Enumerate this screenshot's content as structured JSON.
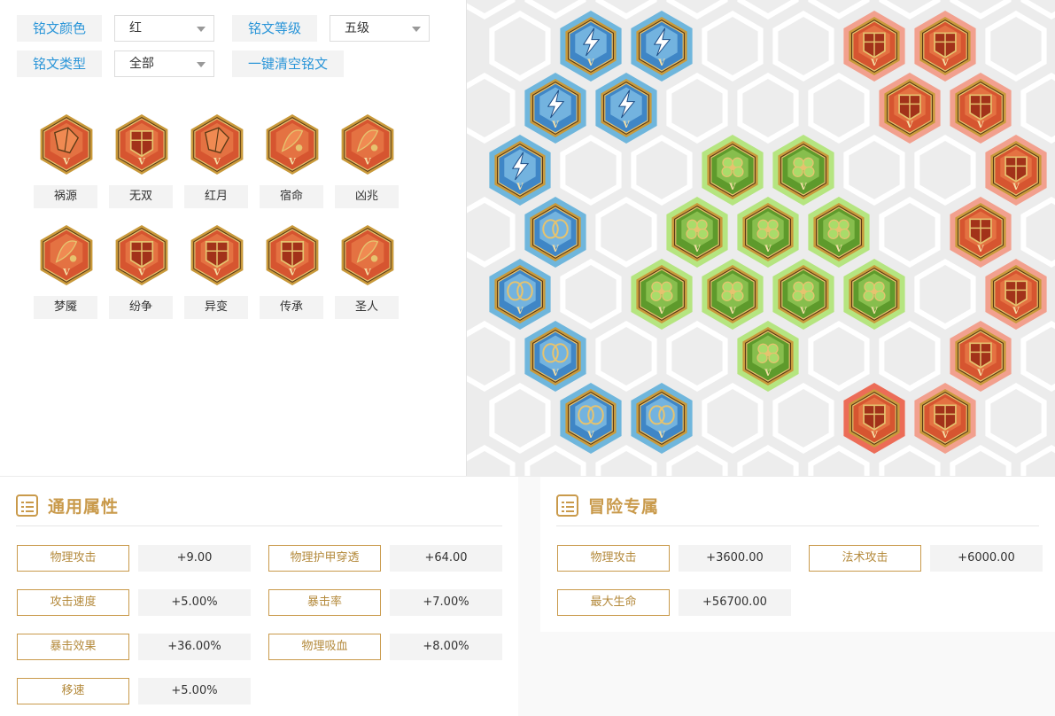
{
  "filters": {
    "color_label": "铭文颜色",
    "color_value": "红",
    "level_label": "铭文等级",
    "level_value": "五级",
    "type_label": "铭文类型",
    "type_value": "全部",
    "clear_button": "一键清空铭文"
  },
  "rune_level_mark": "V",
  "runes": [
    {
      "name": "祸源",
      "icon": "broken-shard-emblem-icon"
    },
    {
      "name": "无双",
      "icon": "shield-emblem-icon"
    },
    {
      "name": "红月",
      "icon": "broken-shard-emblem-icon"
    },
    {
      "name": "宿命",
      "icon": "feather-emblem-icon"
    },
    {
      "name": "凶兆",
      "icon": "feather-emblem-icon"
    },
    {
      "name": "梦魇",
      "icon": "feather-emblem-icon"
    },
    {
      "name": "纷争",
      "icon": "shield-emblem-icon"
    },
    {
      "name": "异变",
      "icon": "shield-emblem-icon"
    },
    {
      "name": "传承",
      "icon": "shield-emblem-icon"
    },
    {
      "name": "圣人",
      "icon": "feather-emblem-icon"
    }
  ],
  "board": {
    "icons": {
      "blue_lightning": "lightning-rune-icon",
      "blue_knot": "knot-rune-icon",
      "green": "clover-rune-icon",
      "red": "gold-shield-rune-icon"
    },
    "colors": {
      "blue": "#6fb6dc",
      "green": "#b5e580",
      "red": "#f2a08e",
      "red_selected": "#ec6c57",
      "empty": "#ffffff",
      "background": "#ececec"
    }
  },
  "general": {
    "title": "通用属性",
    "attrs": [
      {
        "label": "物理攻击",
        "value": "+9.00"
      },
      {
        "label": "物理护甲穿透",
        "value": "+64.00"
      },
      {
        "label": "攻击速度",
        "value": "+5.00%"
      },
      {
        "label": "暴击率",
        "value": "+7.00%"
      },
      {
        "label": "暴击效果",
        "value": "+36.00%"
      },
      {
        "label": "物理吸血",
        "value": "+8.00%"
      },
      {
        "label": "移速",
        "value": "+5.00%"
      }
    ]
  },
  "adventure": {
    "title": "冒险专属",
    "attrs": [
      {
        "label": "物理攻击",
        "value": "+3600.00"
      },
      {
        "label": "法术攻击",
        "value": "+6000.00"
      },
      {
        "label": "最大生命",
        "value": "+56700.00"
      }
    ]
  }
}
